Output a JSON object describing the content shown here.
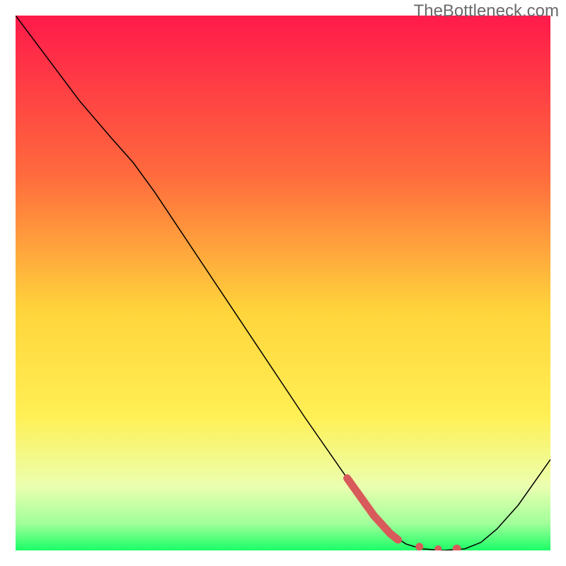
{
  "watermark": "TheBottleneck.com",
  "chart_data": {
    "type": "line",
    "title": "",
    "xlabel": "",
    "ylabel": "",
    "xlim": [
      0,
      100
    ],
    "ylim": [
      0,
      100
    ],
    "gradient_stops": [
      {
        "offset": 0,
        "color": "#ff1a4a"
      },
      {
        "offset": 30,
        "color": "#ff6b3d"
      },
      {
        "offset": 55,
        "color": "#ffd43b"
      },
      {
        "offset": 75,
        "color": "#fff055"
      },
      {
        "offset": 88,
        "color": "#ebffb0"
      },
      {
        "offset": 95,
        "color": "#a0ff9a"
      },
      {
        "offset": 100,
        "color": "#1aff66"
      }
    ],
    "series": [
      {
        "name": "main-curve",
        "color": "#000000",
        "width": 1.5,
        "points": [
          {
            "x": 0,
            "y": 100
          },
          {
            "x": 6,
            "y": 92
          },
          {
            "x": 12,
            "y": 84
          },
          {
            "x": 18,
            "y": 77
          },
          {
            "x": 22,
            "y": 72.5
          },
          {
            "x": 26,
            "y": 67
          },
          {
            "x": 30,
            "y": 61
          },
          {
            "x": 38,
            "y": 49
          },
          {
            "x": 46,
            "y": 37
          },
          {
            "x": 54,
            "y": 25
          },
          {
            "x": 62,
            "y": 13.5
          },
          {
            "x": 67,
            "y": 6.5
          },
          {
            "x": 70,
            "y": 3.2
          },
          {
            "x": 73,
            "y": 1.2
          },
          {
            "x": 76,
            "y": 0.3
          },
          {
            "x": 80,
            "y": 0
          },
          {
            "x": 84,
            "y": 0.3
          },
          {
            "x": 87,
            "y": 1.5
          },
          {
            "x": 90,
            "y": 4
          },
          {
            "x": 94,
            "y": 8.5
          },
          {
            "x": 100,
            "y": 17
          }
        ]
      },
      {
        "name": "highlight-segment",
        "color": "#d85a5a",
        "width": 11,
        "cap": "round",
        "points": [
          {
            "x": 62,
            "y": 13.5
          },
          {
            "x": 67,
            "y": 6.5
          },
          {
            "x": 70,
            "y": 3.2
          },
          {
            "x": 71.5,
            "y": 2.0
          }
        ]
      }
    ],
    "highlight_dots": [
      {
        "x": 75.5,
        "y": 0.7,
        "r": 5.5,
        "color": "#d85a5a"
      },
      {
        "x": 79,
        "y": 0.3,
        "r": 5,
        "color": "#d85a5a"
      },
      {
        "x": 82.5,
        "y": 0.3,
        "r": 6,
        "color": "#d85a5a"
      }
    ]
  }
}
